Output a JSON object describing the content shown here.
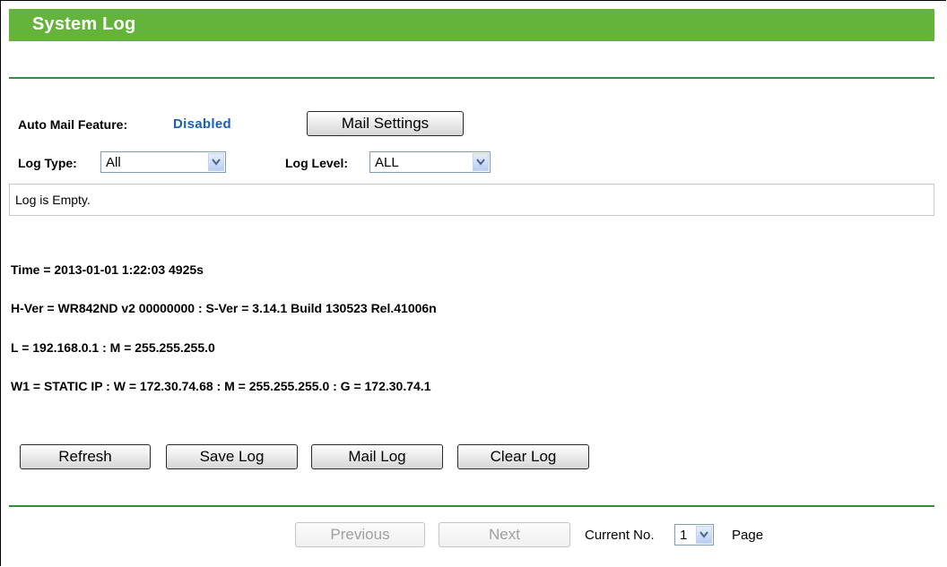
{
  "header": {
    "title": "System Log"
  },
  "mail": {
    "auto_mail_label": "Auto Mail Feature:",
    "auto_mail_status": "Disabled",
    "status_color": "#1a5fb4",
    "settings_button": "Mail Settings"
  },
  "filters": {
    "log_type_label": "Log Type:",
    "log_type_value": "All",
    "log_level_label": "Log Level:",
    "log_level_value": "ALL"
  },
  "log": {
    "content": "Log is Empty."
  },
  "system_info": [
    "Time = 2013-01-01 1:22:03 4925s",
    "H-Ver = WR842ND v2 00000000 : S-Ver = 3.14.1 Build 130523 Rel.41006n",
    "L = 192.168.0.1 : M = 255.255.255.0",
    "W1 = STATIC IP : W = 172.30.74.68 : M = 255.255.255.0 : G = 172.30.74.1"
  ],
  "actions": {
    "refresh": "Refresh",
    "save_log": "Save Log",
    "mail_log": "Mail Log",
    "clear_log": "Clear Log"
  },
  "pagination": {
    "previous": "Previous",
    "next": "Next",
    "current_label": "Current No.",
    "current_value": "1",
    "page_label": "Page"
  },
  "colors": {
    "title_bar": "#64b43c",
    "rule": "#2f8f3c"
  },
  "icons": {
    "select_arrow": "chevron-down-icon"
  }
}
